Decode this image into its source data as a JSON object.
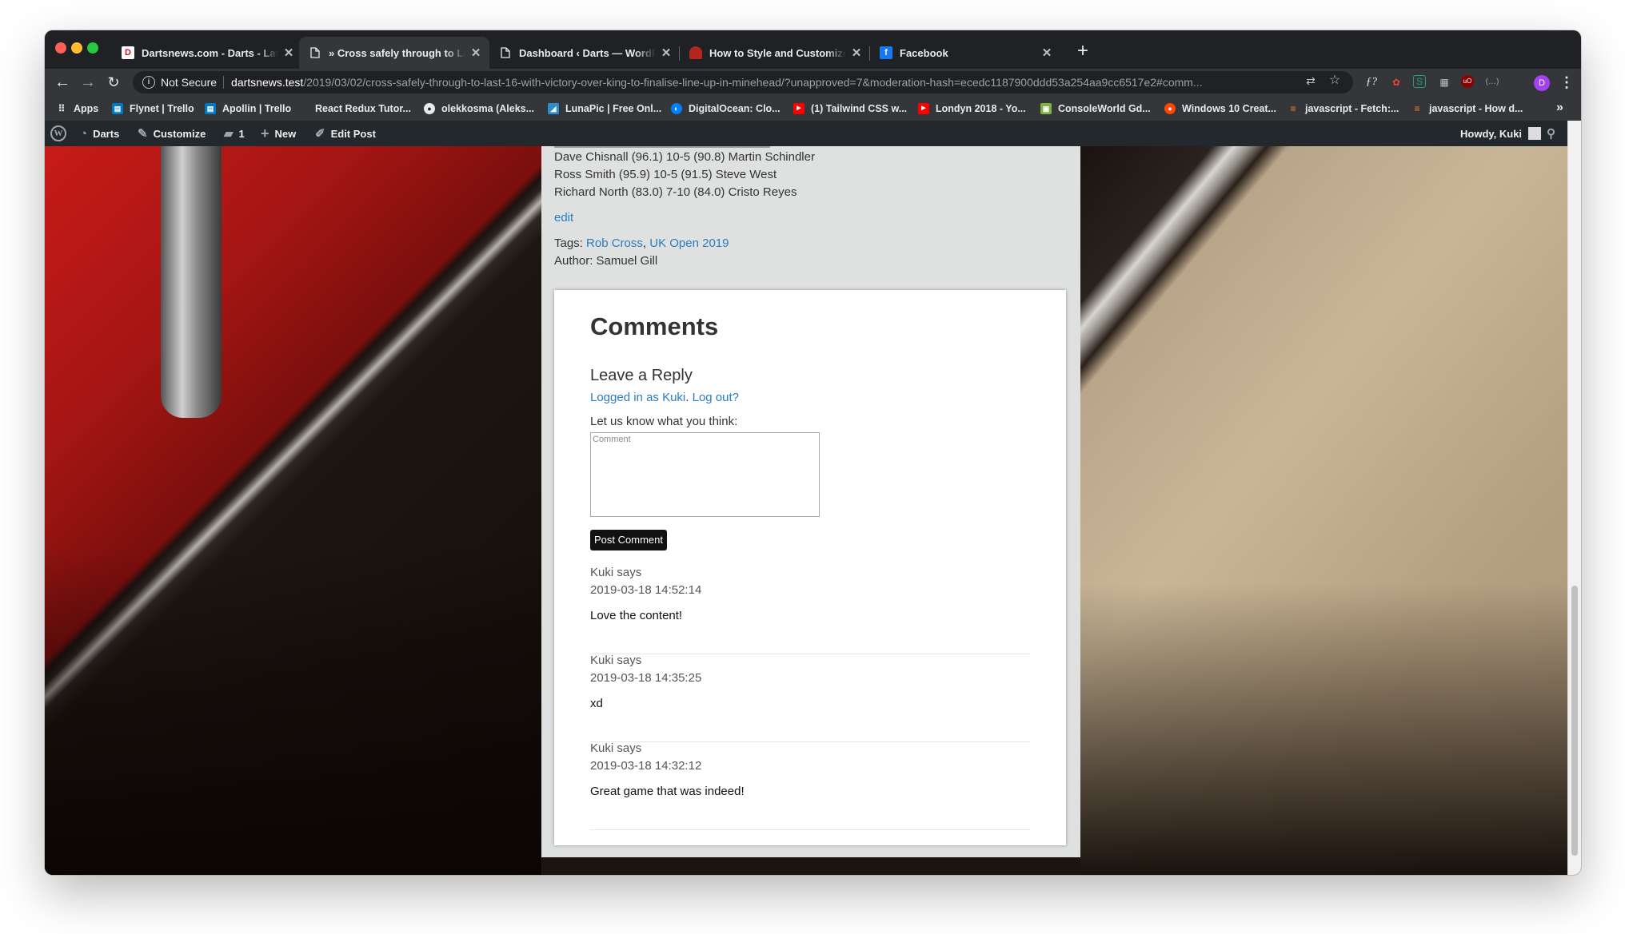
{
  "tabs": [
    {
      "title": "Dartsnews.com - Darts - Latest",
      "favicon": "dartsnews-logo-icon"
    },
    {
      "title": "» Cross safely through to Last",
      "favicon": "document-icon",
      "active": true
    },
    {
      "title": "Dashboard ‹ Darts — WordPress",
      "favicon": "document-icon"
    },
    {
      "title": "How to Style and Customize W",
      "favicon": "site-logo-icon"
    },
    {
      "title": "Facebook",
      "favicon": "facebook-icon"
    }
  ],
  "toolbar": {
    "security_label": "Not Secure",
    "url_domain": "dartsnews.test",
    "url_path": "/2019/03/02/cross-safely-through-to-last-16-with-victory-over-king-to-finalise-line-up-in-minehead/?unapproved=7&moderation-hash=ecedc1187900ddd53a254aa9cc6517e2#comm...",
    "profile_initial": "D"
  },
  "bookmarks": [
    {
      "label": "Apps",
      "icon": "apps-grid-icon"
    },
    {
      "label": "Flynet | Trello",
      "icon": "trello-icon"
    },
    {
      "label": "Apollin | Trello",
      "icon": "trello-icon"
    },
    {
      "label": "React Redux Tutor...",
      "icon": "blank-icon"
    },
    {
      "label": "olekkosma (Aleks...",
      "icon": "github-icon"
    },
    {
      "label": "LunaPic | Free Onl...",
      "icon": "lunapic-icon"
    },
    {
      "label": "DigitalOcean: Clo...",
      "icon": "digitalocean-icon"
    },
    {
      "label": "(1) Tailwind CSS w...",
      "icon": "youtube-icon"
    },
    {
      "label": "Londyn 2018 - Yo...",
      "icon": "youtube-icon"
    },
    {
      "label": "ConsoleWorld Gd...",
      "icon": "consoleworld-icon"
    },
    {
      "label": "Windows 10 Creat...",
      "icon": "reddit-icon"
    },
    {
      "label": "javascript - Fetch:...",
      "icon": "stackoverflow-icon"
    },
    {
      "label": "javascript - How d...",
      "icon": "stackoverflow-icon"
    }
  ],
  "adminbar": {
    "site_name": "Darts",
    "customize": "Customize",
    "comments_count": "1",
    "new_label": "New",
    "edit_post": "Edit Post",
    "howdy": "Howdy, Kuki"
  },
  "post": {
    "results": [
      "Dave Chisnall (96.1) 10-5 (90.8) Martin Schindler",
      "Ross Smith (95.9) 10-5 (91.5) Steve West",
      "Richard North (83.0) 7-10 (84.0) Cristo Reyes"
    ],
    "edit_link": "edit",
    "tags_label": "Tags: ",
    "tags": [
      "Rob Cross",
      "UK Open 2019"
    ],
    "tag_separator": ", ",
    "author": "Author: Samuel Gill"
  },
  "comments": {
    "title": "Comments",
    "reply_title": "Leave a Reply",
    "logged_in_text": "Logged in as Kuki",
    "logged_sep": ". ",
    "logout_text": "Log out?",
    "prompt": "Let us know what you think:",
    "textarea_placeholder": "Comment",
    "submit_label": "Post Comment",
    "items": [
      {
        "author": "Kuki says",
        "date": "2019-03-18 14:52:14",
        "text": "Love the content!"
      },
      {
        "author": "Kuki says",
        "date": "2019-03-18 14:35:25",
        "text": "xd"
      },
      {
        "author": "Kuki says",
        "date": "2019-03-18 14:32:12",
        "text": "Great game that was indeed!"
      }
    ]
  }
}
